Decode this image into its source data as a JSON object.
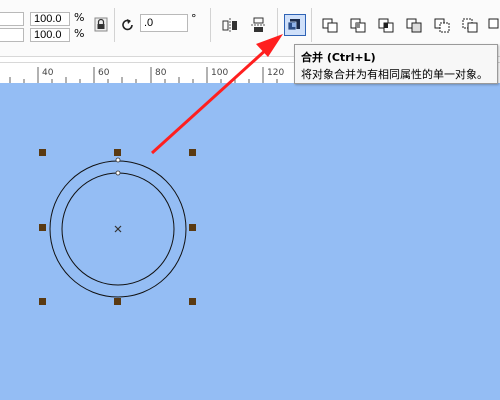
{
  "toolbar": {
    "scale_x": "100.0",
    "scale_y": "100.0",
    "pct_symbol": "%",
    "rotation_value": ".0",
    "degree_symbol": "°"
  },
  "tooltip": {
    "title": "合并 (Ctrl+L)",
    "description": "将对象合并为有相同属性的单一对象。"
  },
  "ruler": {
    "labels": [
      "40",
      "60",
      "80",
      "100",
      "120"
    ]
  },
  "colors": {
    "canvas": "#94bdf4",
    "handle": "#5a3a12",
    "arrow": "#ff1f1f"
  },
  "icons": {
    "lock": "lock-icon",
    "rotate": "rotate-icon",
    "mirror_h": "mirror-horizontal-icon",
    "mirror_v": "mirror-vertical-icon",
    "combine": "combine-icon",
    "weld": "weld-icon",
    "trim": "trim-icon",
    "intersect": "intersect-icon",
    "simplify": "simplify-icon",
    "front_minus_back": "front-minus-back-icon",
    "back_minus_front": "back-minus-front-icon",
    "boundary": "boundary-icon"
  }
}
